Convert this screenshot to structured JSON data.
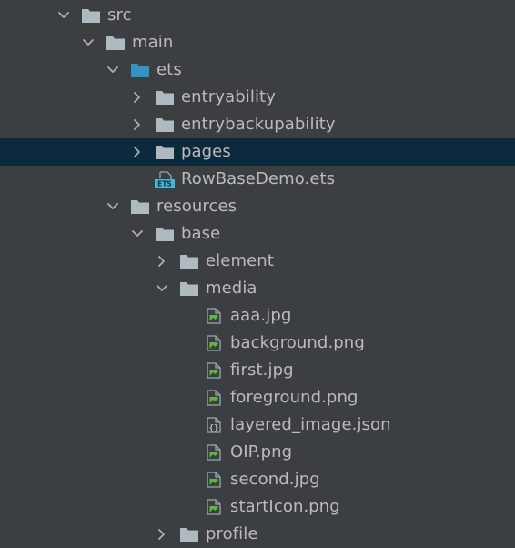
{
  "project_tree": {
    "items": [
      {
        "label": "src",
        "depth": 0,
        "expandable": true,
        "expanded": true,
        "icon": "folder-icon",
        "selected": false
      },
      {
        "label": "main",
        "depth": 1,
        "expandable": true,
        "expanded": true,
        "icon": "folder-icon",
        "selected": false
      },
      {
        "label": "ets",
        "depth": 2,
        "expandable": true,
        "expanded": true,
        "icon": "source-folder-icon",
        "selected": false
      },
      {
        "label": "entryability",
        "depth": 3,
        "expandable": true,
        "expanded": false,
        "icon": "folder-icon",
        "selected": false
      },
      {
        "label": "entrybackupability",
        "depth": 3,
        "expandable": true,
        "expanded": false,
        "icon": "folder-icon",
        "selected": false
      },
      {
        "label": "pages",
        "depth": 3,
        "expandable": true,
        "expanded": false,
        "icon": "folder-icon",
        "selected": true
      },
      {
        "label": "RowBaseDemo.ets",
        "depth": 3,
        "expandable": false,
        "expanded": false,
        "icon": "ets-file-icon",
        "selected": false
      },
      {
        "label": "resources",
        "depth": 2,
        "expandable": true,
        "expanded": true,
        "icon": "folder-icon",
        "selected": false
      },
      {
        "label": "base",
        "depth": 3,
        "expandable": true,
        "expanded": true,
        "icon": "folder-icon",
        "selected": false
      },
      {
        "label": "element",
        "depth": 4,
        "expandable": true,
        "expanded": false,
        "icon": "folder-icon",
        "selected": false
      },
      {
        "label": "media",
        "depth": 4,
        "expandable": true,
        "expanded": true,
        "icon": "folder-icon",
        "selected": false
      },
      {
        "label": "aaa.jpg",
        "depth": 5,
        "expandable": false,
        "expanded": false,
        "icon": "image-file-icon",
        "selected": false
      },
      {
        "label": "background.png",
        "depth": 5,
        "expandable": false,
        "expanded": false,
        "icon": "image-file-icon",
        "selected": false
      },
      {
        "label": "first.jpg",
        "depth": 5,
        "expandable": false,
        "expanded": false,
        "icon": "image-file-icon",
        "selected": false
      },
      {
        "label": "foreground.png",
        "depth": 5,
        "expandable": false,
        "expanded": false,
        "icon": "image-file-icon",
        "selected": false
      },
      {
        "label": "layered_image.json",
        "depth": 5,
        "expandable": false,
        "expanded": false,
        "icon": "json-file-icon",
        "selected": false
      },
      {
        "label": "OIP.png",
        "depth": 5,
        "expandable": false,
        "expanded": false,
        "icon": "image-file-icon",
        "selected": false
      },
      {
        "label": "second.jpg",
        "depth": 5,
        "expandable": false,
        "expanded": false,
        "icon": "image-file-icon",
        "selected": false
      },
      {
        "label": "startIcon.png",
        "depth": 5,
        "expandable": false,
        "expanded": false,
        "icon": "image-file-icon",
        "selected": false
      },
      {
        "label": "profile",
        "depth": 4,
        "expandable": true,
        "expanded": false,
        "icon": "folder-icon",
        "selected": false
      }
    ]
  },
  "colors": {
    "background": "#3c3f41",
    "selected_row": "#0d293e",
    "text": "#bbbbbb",
    "folder": "#aeb9c0",
    "source_folder": "#3592c4",
    "chevron": "#aeaeae",
    "image_green": "#62b543",
    "ets_blue": "#40b6e0"
  }
}
